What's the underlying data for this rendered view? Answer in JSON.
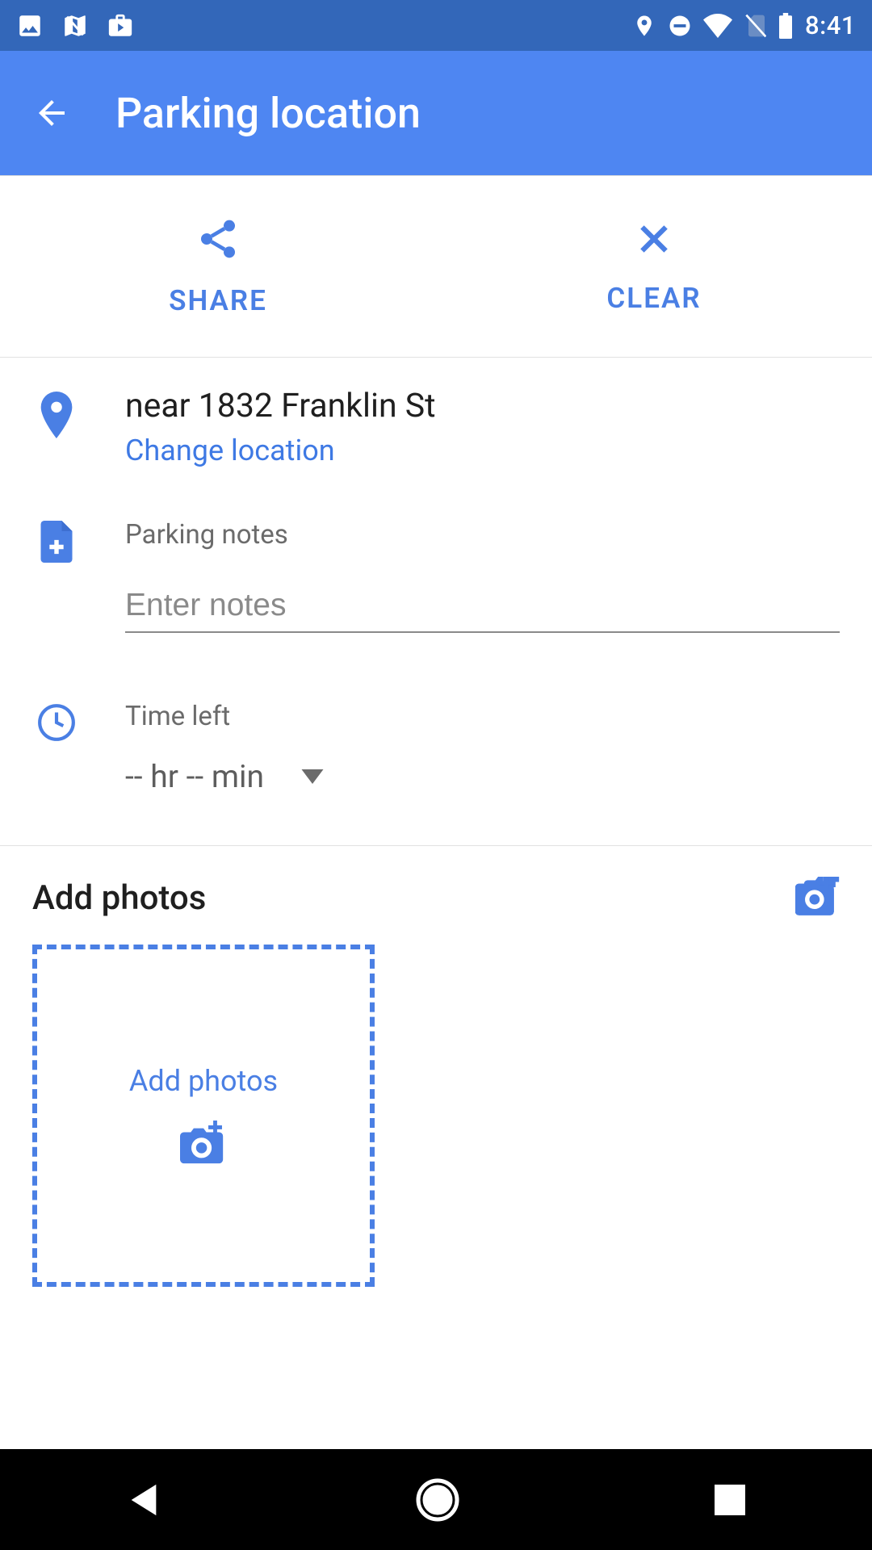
{
  "statusbar": {
    "clock": "8:41"
  },
  "appbar": {
    "title": "Parking location"
  },
  "actions": {
    "share_label": "SHARE",
    "clear_label": "CLEAR"
  },
  "location": {
    "address": "near 1832 Franklin St",
    "change_label": "Change location"
  },
  "notes": {
    "label": "Parking notes",
    "placeholder": "Enter notes",
    "value": ""
  },
  "time": {
    "label": "Time left",
    "value": "-- hr -- min"
  },
  "photos": {
    "section_title": "Add photos",
    "add_cta": "Add photos"
  }
}
